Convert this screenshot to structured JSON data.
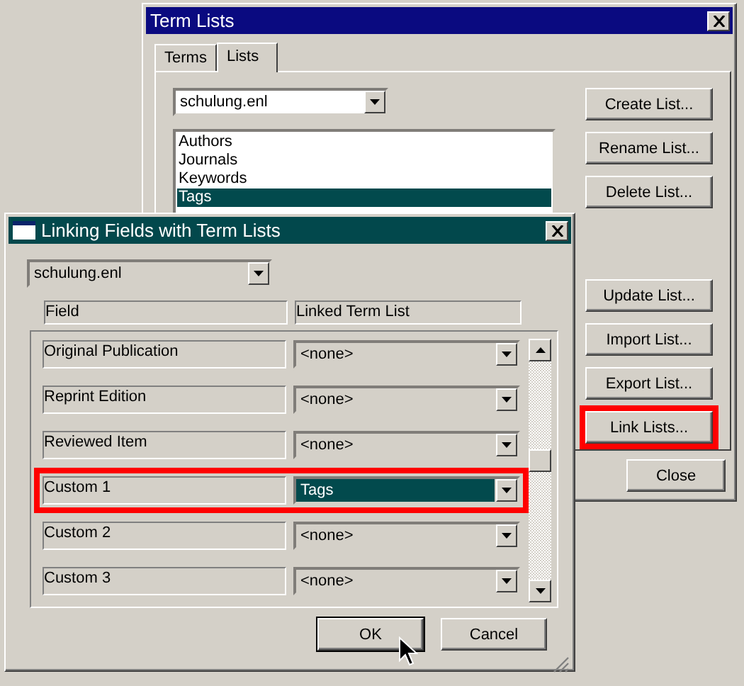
{
  "term_lists_window": {
    "title": "Term Lists",
    "tabs": [
      {
        "label": "Terms",
        "selected": false
      },
      {
        "label": "Lists",
        "selected": true
      }
    ],
    "library": "schulung.enl",
    "lists": [
      {
        "label": "Authors",
        "selected": false
      },
      {
        "label": "Journals",
        "selected": false
      },
      {
        "label": "Keywords",
        "selected": false
      },
      {
        "label": "Tags",
        "selected": true
      }
    ],
    "buttons_top": [
      {
        "label": "Create List...",
        "highlighted": false
      },
      {
        "label": "Rename List...",
        "highlighted": false
      },
      {
        "label": "Delete List...",
        "highlighted": false
      }
    ],
    "buttons_bottom": [
      {
        "label": "Update List...",
        "highlighted": false
      },
      {
        "label": "Import List...",
        "highlighted": false
      },
      {
        "label": "Export List...",
        "highlighted": false
      },
      {
        "label": "Link Lists...",
        "highlighted": true
      }
    ],
    "close": "Close"
  },
  "linking_window": {
    "title": "Linking Fields with Term Lists",
    "library": "schulung.enl",
    "columns": [
      "Field",
      "Linked Term List"
    ],
    "rows": [
      {
        "field": "Original Publication",
        "list": "<none>",
        "selected": false,
        "highlighted": false
      },
      {
        "field": "Reprint Edition",
        "list": "<none>",
        "selected": false,
        "highlighted": false
      },
      {
        "field": "Reviewed Item",
        "list": "<none>",
        "selected": false,
        "highlighted": false
      },
      {
        "field": "Custom 1",
        "list": "Tags",
        "selected": true,
        "highlighted": true
      },
      {
        "field": "Custom 2",
        "list": "<none>",
        "selected": false,
        "highlighted": false
      },
      {
        "field": "Custom 3",
        "list": "<none>",
        "selected": false,
        "highlighted": false
      }
    ],
    "buttons": [
      "OK",
      "Cancel"
    ]
  }
}
